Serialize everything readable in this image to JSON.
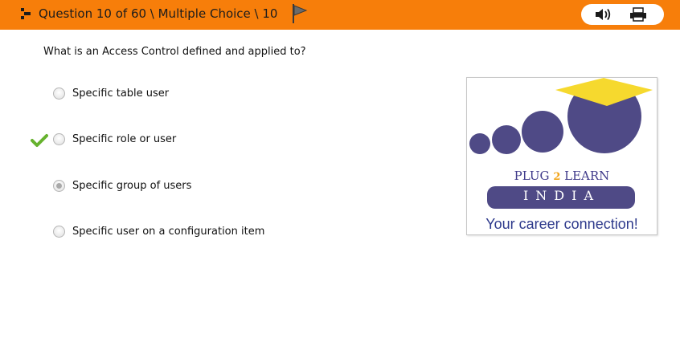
{
  "header": {
    "title": "Question 10 of 60 \\ Multiple Choice \\ 10",
    "grip_icon": "drag-handle-icon",
    "flag_icon": "flag-icon",
    "audio_icon": "speaker-icon",
    "print_icon": "printer-icon",
    "bar_color": "#f77e0a"
  },
  "question": {
    "text": "What is an Access Control defined and applied to?"
  },
  "choices": [
    {
      "label": "Specific table user",
      "selected": false,
      "correct": false
    },
    {
      "label": "Specific role or user",
      "selected": false,
      "correct": true
    },
    {
      "label": "Specific group of users",
      "selected": true,
      "correct": false
    },
    {
      "label": "Specific user on a configuration item",
      "selected": false,
      "correct": false
    }
  ],
  "logo": {
    "brand_part1": "PLUG",
    "brand_num": "2",
    "brand_part2": "LEARN",
    "country": "INDIA",
    "tagline": "Your career connection!",
    "purple": "#4f4a86",
    "gold": "#f6d92e"
  }
}
